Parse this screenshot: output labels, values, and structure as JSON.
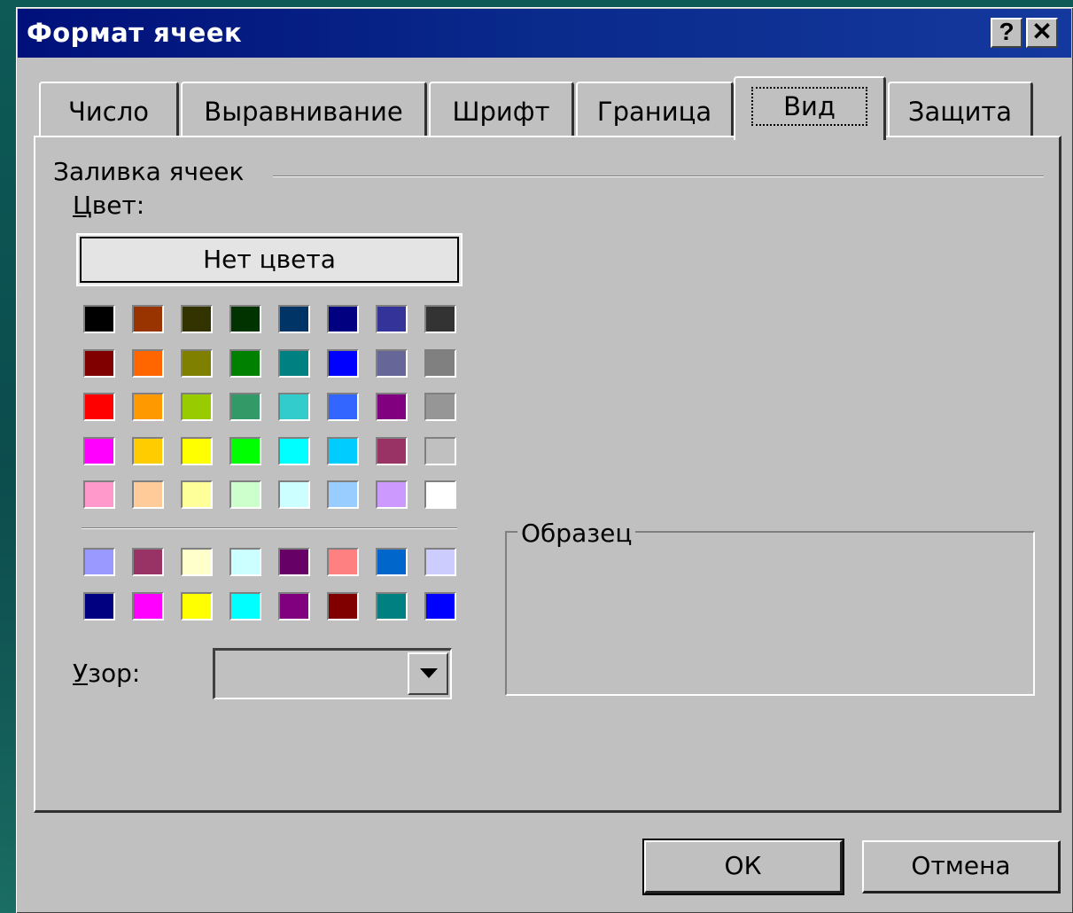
{
  "window": {
    "title": "Формат ячеек",
    "help_label": "?",
    "close_label": "✕"
  },
  "tabs": [
    {
      "label": "Число",
      "active": false
    },
    {
      "label": "Выравнивание",
      "active": false
    },
    {
      "label": "Шрифт",
      "active": false
    },
    {
      "label": "Граница",
      "active": false
    },
    {
      "label": "Вид",
      "active": true
    },
    {
      "label": "Защита",
      "active": false
    }
  ],
  "fill": {
    "group_label": "Заливка ячеек",
    "color_label_accel": "Ц",
    "color_label_rest": "вет:",
    "no_color_button": "Нет цвета",
    "palette": [
      [
        "#000000",
        "#993300",
        "#333300",
        "#003300",
        "#003366",
        "#000080",
        "#333399",
        "#333333"
      ],
      [
        "#800000",
        "#FF6600",
        "#808000",
        "#008000",
        "#008080",
        "#0000FF",
        "#666699",
        "#808080"
      ],
      [
        "#FF0000",
        "#FF9900",
        "#99CC00",
        "#339966",
        "#33CCCC",
        "#3366FF",
        "#800080",
        "#969696"
      ],
      [
        "#FF00FF",
        "#FFCC00",
        "#FFFF00",
        "#00FF00",
        "#00FFFF",
        "#00CCFF",
        "#993366",
        "#C0C0C0"
      ],
      [
        "#FF99CC",
        "#FFCC99",
        "#FFFF99",
        "#CCFFCC",
        "#CCFFFF",
        "#99CCFF",
        "#CC99FF",
        "#FFFFFF"
      ]
    ],
    "chart_palette": [
      [
        "#9999FF",
        "#993366",
        "#FFFFCC",
        "#CCFFFF",
        "#660066",
        "#FF8080",
        "#0066CC",
        "#CCCCFF"
      ],
      [
        "#000080",
        "#FF00FF",
        "#FFFF00",
        "#00FFFF",
        "#800080",
        "#800000",
        "#008080",
        "#0000FF"
      ]
    ],
    "pattern_label_accel": "У",
    "pattern_label_rest": "зор:",
    "pattern_value": ""
  },
  "sample": {
    "label": "Образец"
  },
  "buttons": {
    "ok": "ОК",
    "cancel": "Отмена"
  }
}
